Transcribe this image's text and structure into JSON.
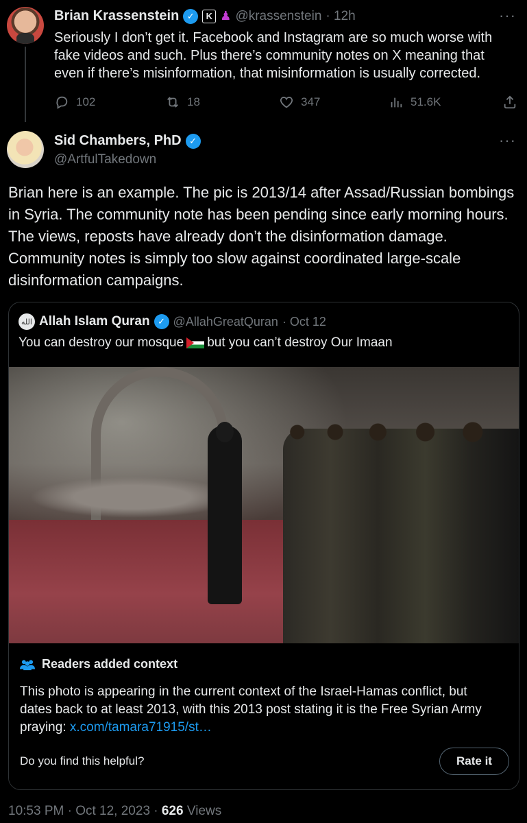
{
  "tweet1": {
    "name": "Brian Krassenstein",
    "affiliation_badge": "K",
    "handle": "@krassenstein",
    "time": "· 12h",
    "more": "···",
    "text": "Seriously I don’t get it. Facebook and Instagram are so much worse with fake videos and such. Plus there’s community notes on X meaning that even if there’s misinformation, that misinformation is usually corrected.",
    "replies": "102",
    "reposts": "18",
    "likes": "347",
    "views": "51.6K"
  },
  "tweet2": {
    "name": "Sid Chambers, PhD",
    "handle": "@ArtfulTakedown",
    "more": "···",
    "text": "Brian here is an example.  The pic is 2013/14 after Assad/Russian bombings in Syria.  The community note has been pending since early morning hours.  The views, reposts have already don’t the disinformation damage.  Community notes is simply too slow against coordinated large-scale disinformation campaigns."
  },
  "quote": {
    "avatar_glyph": "الله",
    "name": "Allah Islam Quran",
    "handle": "@AllahGreatQuran",
    "time": "· Oct 12",
    "text_before": "You can destroy our mosque",
    "text_after": "but you can’t destroy Our Imaan"
  },
  "note": {
    "title": "Readers added context",
    "text": "This photo is appearing in the current context of the Israel-Hamas conflict, but dates back to at least 2013, with this 2013 post stating it is the Free Syrian Army praying: ",
    "link": "x.com/tamara71915/st…",
    "question": "Do you find this helpful?",
    "rate_button": "Rate it"
  },
  "footer": {
    "timestamp": "10:53 PM · Oct 12, 2023 ·",
    "views_count": "626",
    "views_label": "Views"
  },
  "colors": {
    "background": "#000000",
    "text": "#e7e9ea",
    "muted": "#71767b",
    "accent": "#1d9bf0",
    "border": "#2f3336"
  },
  "icons": [
    "reply-icon",
    "repost-icon",
    "like-icon",
    "views-icon",
    "share-icon",
    "verified-icon",
    "community-notes-icon",
    "palestine-flag-icon"
  ]
}
